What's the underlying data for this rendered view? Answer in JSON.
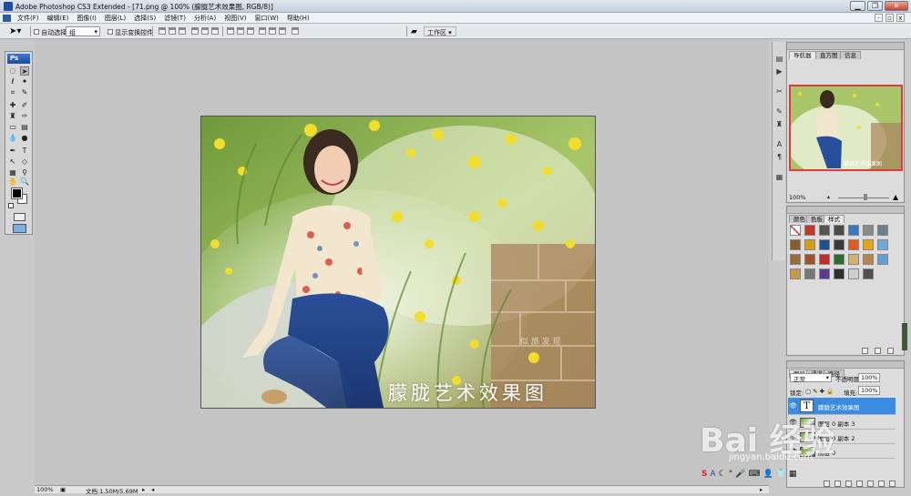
{
  "window": {
    "title": "Adobe Photoshop CS3 Extended - [71.png @ 100% (朦胧艺术效果图, RGB/8)]",
    "minimize": "▁",
    "restore": "❐",
    "close": "✕"
  },
  "menu": {
    "items": [
      "文件(F)",
      "编辑(E)",
      "图像(I)",
      "图层(L)",
      "选择(S)",
      "滤镜(T)",
      "分析(A)",
      "视图(V)",
      "窗口(W)",
      "帮助(H)"
    ]
  },
  "options": {
    "auto_select_label": "自动选择:",
    "auto_select_value": "组",
    "show_transform_label": "显示变换控件",
    "workspace_label": "工作区 ▾"
  },
  "tools": {
    "logo": "Ps"
  },
  "document": {
    "overlay_title": "朦胧艺术效果图",
    "watermark_small": "似 旅 发 现"
  },
  "status": {
    "zoom": "100%",
    "doc_info": "文档:1.50M/5.69M"
  },
  "navigator": {
    "tabs": [
      "导航器",
      "直方图",
      "信息"
    ],
    "zoom": "100%",
    "thumb_text": "朦胧艺术效果图"
  },
  "styles_panel": {
    "tabs": [
      "颜色",
      "色板",
      "样式"
    ],
    "swatch_colors": [
      "#ffffff",
      "#c0392b",
      "#555555",
      "#4a4a4a",
      "#3778c2",
      "#8a8a8a",
      "#6d7f8c",
      "#8b5a2b",
      "#d4a017",
      "#1f4f8f",
      "#3a3a3a",
      "#e05a1b",
      "#e8a317",
      "#6fa9d8",
      "#9a6b3a",
      "#a0522d",
      "#c52b2b",
      "#2e6b2e",
      "#d2b26b",
      "#b8864b",
      "#5fa0d8",
      "#c49a4a",
      "#777777",
      "#5b3b8f",
      "#2f2f2f",
      "#cfcfcf",
      "#505050"
    ]
  },
  "layers": {
    "tabs": [
      "图层",
      "通道",
      "路径"
    ],
    "blend_mode": "正常",
    "opacity_label": "不透明度:",
    "opacity_value": "100%",
    "lock_label": "锁定:",
    "fill_label": "填充:",
    "fill_value": "100%",
    "items": [
      {
        "name": "朦胧艺术效果图",
        "type_icon": "T"
      },
      {
        "name": "图层 0 副本 3"
      },
      {
        "name": "图层 0 副本 2"
      },
      {
        "name": "图层 0"
      }
    ]
  },
  "watermark": {
    "brand": "Bai 经验",
    "url": "jingyan.baidu.com"
  }
}
